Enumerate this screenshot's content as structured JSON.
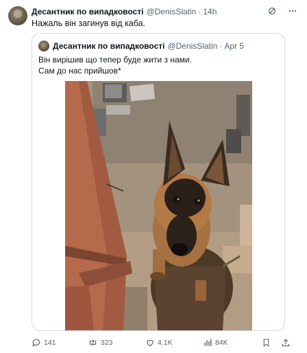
{
  "tweet": {
    "author_name": "Десантник по випадковості",
    "author_handle": "@DenisSlatin",
    "separator": "·",
    "time": "14h",
    "text": "Нажаль він загинув від каба."
  },
  "quote": {
    "author_name": "Десантник по випадковості",
    "author_handle": "@DenisSlatin",
    "separator": "·",
    "date": "Apr 5",
    "lines": [
      "Він вирішив що тепер буде жити з нами.",
      "Сам до нас прийшов*"
    ]
  },
  "actions": {
    "replies": "141",
    "reposts": "323",
    "likes": "4.1K",
    "views": "84K"
  },
  "icons": {
    "grok": "grok-icon",
    "more": "more-icon",
    "reply": "reply-icon",
    "repost": "repost-icon",
    "like": "heart-icon",
    "views": "views-icon",
    "bookmark": "bookmark-icon",
    "share": "share-icon"
  },
  "colors": {
    "text": "#0f1419",
    "secondary": "#536471",
    "border": "#cfd9de"
  }
}
